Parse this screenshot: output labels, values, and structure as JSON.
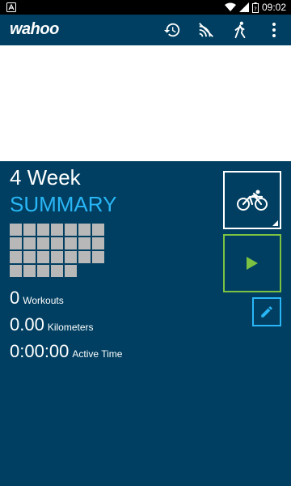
{
  "status_bar": {
    "time": "09:02",
    "icons": [
      "notification-a-icon",
      "wifi-icon",
      "signal-icon",
      "battery-icon"
    ]
  },
  "app_bar": {
    "logo": "wahoo",
    "actions": [
      "history-icon",
      "sensors-icon",
      "activity-profile-icon",
      "overflow-menu-icon"
    ]
  },
  "summary": {
    "heading_line1": "4 Week",
    "heading_line2": "SUMMARY",
    "workouts_value": "0",
    "workouts_label": "Workouts",
    "distance_value": "0.00",
    "distance_label": "Kilometers",
    "time_value": "0:00:00",
    "time_label": "Active Time"
  },
  "colors": {
    "background": "#003f61",
    "accent_blue": "#29b6f6",
    "accent_green": "#7cc242",
    "grid_cell": "#b8b8b8"
  }
}
